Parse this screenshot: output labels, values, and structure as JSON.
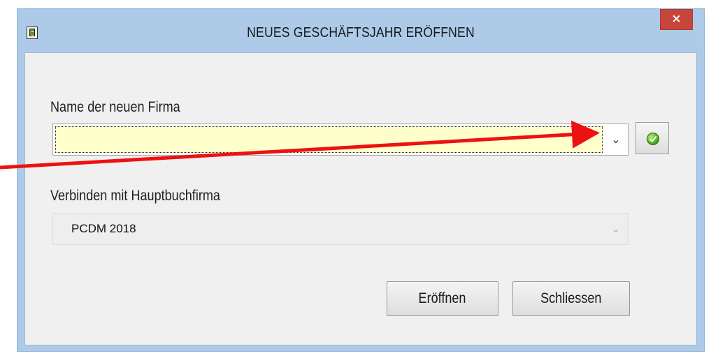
{
  "window": {
    "title": "NEUES GESCHÄFTSJAHR ERÖFFNEN",
    "close_label": "×",
    "icon": "app-document-icon"
  },
  "form": {
    "company_name": {
      "label": "Name der neuen Firma",
      "value": "",
      "dropdown_glyph": "⌄",
      "confirm_icon": "green-check-icon"
    },
    "ledger_company": {
      "label": "Verbinden mit Hauptbuchfirma",
      "value": "PCDM 2018",
      "dropdown_glyph": "⌄"
    }
  },
  "buttons": {
    "open_label": "Eröffnen",
    "close_label": "Schliessen"
  },
  "annotation": {
    "type": "red-arrow",
    "color": "#ee1111"
  },
  "colors": {
    "title_bar": "#adcbe9",
    "close_button": "#c7463b",
    "input_highlight": "#ffffcc",
    "client_background": "#f0f0f0"
  }
}
